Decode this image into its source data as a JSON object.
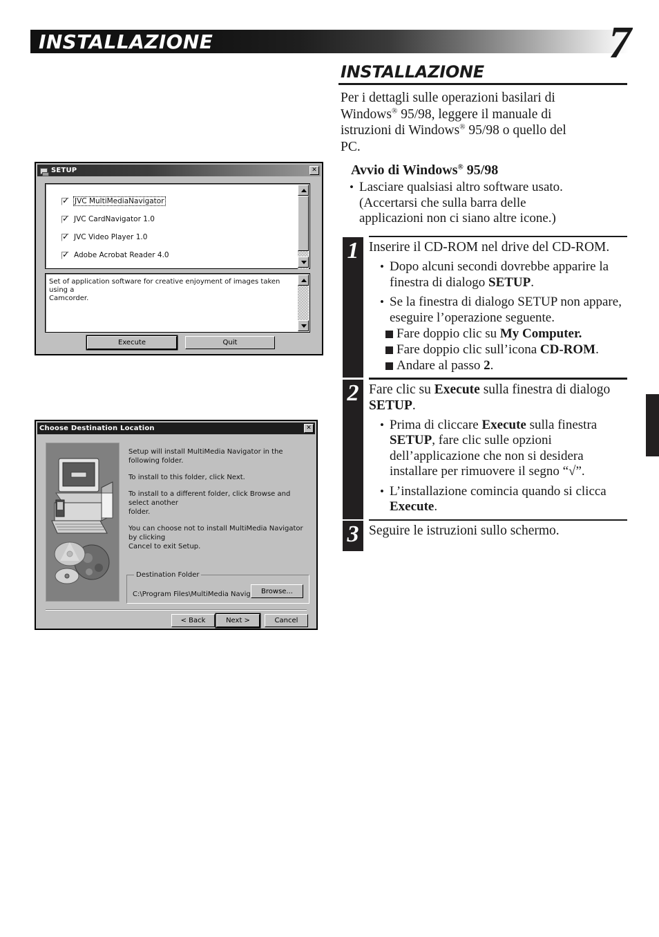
{
  "header": {
    "title": "INSTALLAZIONE",
    "page_number": "7"
  },
  "section": {
    "title": "INSTALLAZIONE",
    "intro_line1": "Per i dettagli sulle operazioni basilari di",
    "intro_line2a": "Windows",
    "intro_reg": "®",
    "intro_line2b": " 95/98, leggere il manuale di",
    "intro_line3a": "istruzioni di Windows",
    "intro_line3b": " 95/98 o quello del",
    "intro_line4": "PC.",
    "subhead_a": "Avvio di Windows",
    "subhead_b": " 95/98",
    "bullet1_line1": "Lasciare qualsiasi altro software usato.",
    "bullet1_line2": "(Accertarsi che sulla barra delle",
    "bullet1_line3": "applicazioni non ci siano altre icone.)"
  },
  "steps": [
    {
      "number": "1",
      "lead": "Inserire il CD-ROM nel drive del CD-ROM.",
      "bullets": [
        {
          "pre": "Dopo alcuni secondi dovrebbe apparire la finestra di dialogo ",
          "bold": "SETUP",
          "post": "."
        },
        {
          "pre": "Se la finestra di dialogo SETUP non appare, eseguire l’operazione seguente.",
          "bold": "",
          "post": ""
        }
      ],
      "squares": [
        {
          "pre": "Fare doppio clic su ",
          "bold": "My Computer.",
          "post": ""
        },
        {
          "pre": "Fare doppio clic sull’icona ",
          "bold": "CD-ROM",
          "post": "."
        },
        {
          "pre": "Andare al passo ",
          "bold": "2",
          "post": "."
        }
      ]
    },
    {
      "number": "2",
      "lead_pre": "Fare clic su ",
      "lead_bold1": "Execute",
      "lead_mid": " sulla finestra di dialogo ",
      "lead_bold2": "SETUP",
      "lead_post": ".",
      "bullets": [
        {
          "p1": "Prima di cliccare ",
          "b1": "Execute",
          "p2": " sulla finestra ",
          "b2": "SETUP",
          "p3": ", fare clic sulle opzioni dell’applicazione che non si desidera installare per rimuovere il segno “√”."
        },
        {
          "p1": "L’installazione comincia quando si clicca ",
          "b1": "Execute",
          "p2": ".",
          "b2": "",
          "p3": ""
        }
      ]
    },
    {
      "number": "3",
      "lead": "Seguire le istruzioni sullo schermo."
    }
  ],
  "setup_dialog": {
    "title": "SETUP",
    "title_icon": "setup-window-icon",
    "close_label": "✕",
    "items": [
      {
        "label": "JVC MultiMediaNavigator",
        "checked": true,
        "focused": true
      },
      {
        "label": "JVC CardNavigator 1.0",
        "checked": true,
        "focused": false
      },
      {
        "label": "JVC Video Player 1.0",
        "checked": true,
        "focused": false
      },
      {
        "label": "Adobe Acrobat Reader 4.0",
        "checked": true,
        "focused": false
      }
    ],
    "description_line1": "Set of application software for creative enjoyment of images taken using a",
    "description_line2": "Camcorder.",
    "execute_label": "Execute",
    "quit_label": "Quit"
  },
  "destination_dialog": {
    "title": "Choose Destination Location",
    "close_label": "✕",
    "body_line1": "Setup will install MultiMedia Navigator in the following folder.",
    "body_line2": "To install to this folder, click Next.",
    "body_line3a": "To install to a different folder, click Browse and select another",
    "body_line3b": "folder.",
    "body_line4a": "You can choose not to install MultiMedia Navigator by clicking",
    "body_line4b": "Cancel to exit Setup.",
    "group_label": "Destination Folder",
    "folder_path": "C:\\Program Files\\MultiMedia Navigator",
    "browse_label": "Browse...",
    "back_label": "< Back",
    "next_label": "Next >",
    "cancel_label": "Cancel",
    "illustration": "computer-cd-globe-illustration"
  },
  "colors": {
    "ink": "#1a1a1a",
    "win_face": "#c0c0c0",
    "win_title": "#1d1d1d"
  }
}
